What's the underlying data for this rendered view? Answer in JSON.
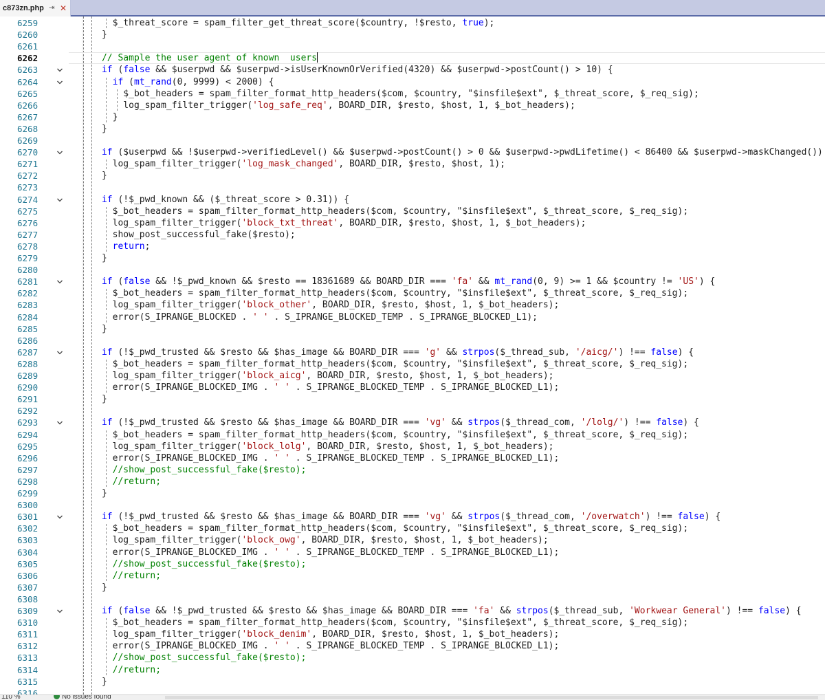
{
  "tab": {
    "title": "c873zn.php",
    "pin": "⇥",
    "close": "✕"
  },
  "status": {
    "zoom": "110 %",
    "issues": "No issues found"
  },
  "lines": [
    {
      "n": "6259",
      "code": "    $_threat_score = spam_filter_get_threat_score($country, !$resto, true);",
      "fold": false
    },
    {
      "n": "6260",
      "code": "  }",
      "fold": false
    },
    {
      "n": "6261",
      "code": "",
      "fold": false
    },
    {
      "n": "6262",
      "code": "  // Sample the user agent of known  users",
      "fold": false,
      "current": true
    },
    {
      "n": "6263",
      "code": "  if (false && $userpwd && $userpwd->isUserKnownOrVerified(4320) && $userpwd->postCount() > 10) {",
      "fold": true
    },
    {
      "n": "6264",
      "code": "    if (mt_rand(0, 9999) < 2000) {",
      "fold": true
    },
    {
      "n": "6265",
      "code": "      $_bot_headers = spam_filter_format_http_headers($com, $country, \"$insfile$ext\", $_threat_score, $_req_sig);",
      "fold": false
    },
    {
      "n": "6266",
      "code": "      log_spam_filter_trigger('log_safe_req', BOARD_DIR, $resto, $host, 1, $_bot_headers);",
      "fold": false
    },
    {
      "n": "6267",
      "code": "    }",
      "fold": false
    },
    {
      "n": "6268",
      "code": "  }",
      "fold": false
    },
    {
      "n": "6269",
      "code": "",
      "fold": false
    },
    {
      "n": "6270",
      "code": "  if ($userpwd && !$userpwd->verifiedLevel() && $userpwd->postCount() > 0 && $userpwd->pwdLifetime() < 86400 && $userpwd->maskChanged()) {",
      "fold": true
    },
    {
      "n": "6271",
      "code": "    log_spam_filter_trigger('log_mask_changed', BOARD_DIR, $resto, $host, 1);",
      "fold": false
    },
    {
      "n": "6272",
      "code": "  }",
      "fold": false
    },
    {
      "n": "6273",
      "code": "",
      "fold": false
    },
    {
      "n": "6274",
      "code": "  if (!$_pwd_known && ($_threat_score > 0.31)) {",
      "fold": true
    },
    {
      "n": "6275",
      "code": "    $_bot_headers = spam_filter_format_http_headers($com, $country, \"$insfile$ext\", $_threat_score, $_req_sig);",
      "fold": false
    },
    {
      "n": "6276",
      "code": "    log_spam_filter_trigger('block_txt_threat', BOARD_DIR, $resto, $host, 1, $_bot_headers);",
      "fold": false
    },
    {
      "n": "6277",
      "code": "    show_post_successful_fake($resto);",
      "fold": false
    },
    {
      "n": "6278",
      "code": "    return;",
      "fold": false
    },
    {
      "n": "6279",
      "code": "  }",
      "fold": false
    },
    {
      "n": "6280",
      "code": "",
      "fold": false
    },
    {
      "n": "6281",
      "code": "  if (false && !$_pwd_known && $resto == 18361689 && BOARD_DIR === 'fa' && mt_rand(0, 9) >= 1 && $country != 'US') {",
      "fold": true
    },
    {
      "n": "6282",
      "code": "    $_bot_headers = spam_filter_format_http_headers($com, $country, \"$insfile$ext\", $_threat_score, $_req_sig);",
      "fold": false
    },
    {
      "n": "6283",
      "code": "    log_spam_filter_trigger('block_other', BOARD_DIR, $resto, $host, 1, $_bot_headers);",
      "fold": false
    },
    {
      "n": "6284",
      "code": "    error(S_IPRANGE_BLOCKED . ' ' . S_IPRANGE_BLOCKED_TEMP . S_IPRANGE_BLOCKED_L1);",
      "fold": false
    },
    {
      "n": "6285",
      "code": "  }",
      "fold": false
    },
    {
      "n": "6286",
      "code": "",
      "fold": false
    },
    {
      "n": "6287",
      "code": "  if (!$_pwd_trusted && $resto && $has_image && BOARD_DIR === 'g' && strpos($_thread_sub, '/aicg/') !== false) {",
      "fold": true
    },
    {
      "n": "6288",
      "code": "    $_bot_headers = spam_filter_format_http_headers($com, $country, \"$insfile$ext\", $_threat_score, $_req_sig);",
      "fold": false
    },
    {
      "n": "6289",
      "code": "    log_spam_filter_trigger('block_aicg', BOARD_DIR, $resto, $host, 1, $_bot_headers);",
      "fold": false
    },
    {
      "n": "6290",
      "code": "    error(S_IPRANGE_BLOCKED_IMG . ' ' . S_IPRANGE_BLOCKED_TEMP . S_IPRANGE_BLOCKED_L1);",
      "fold": false
    },
    {
      "n": "6291",
      "code": "  }",
      "fold": false
    },
    {
      "n": "6292",
      "code": "",
      "fold": false
    },
    {
      "n": "6293",
      "code": "  if (!$_pwd_trusted && $resto && $has_image && BOARD_DIR === 'vg' && strpos($_thread_com, '/lolg/') !== false) {",
      "fold": true
    },
    {
      "n": "6294",
      "code": "    $_bot_headers = spam_filter_format_http_headers($com, $country, \"$insfile$ext\", $_threat_score, $_req_sig);",
      "fold": false
    },
    {
      "n": "6295",
      "code": "    log_spam_filter_trigger('block_lolg', BOARD_DIR, $resto, $host, 1, $_bot_headers);",
      "fold": false
    },
    {
      "n": "6296",
      "code": "    error(S_IPRANGE_BLOCKED_IMG . ' ' . S_IPRANGE_BLOCKED_TEMP . S_IPRANGE_BLOCKED_L1);",
      "fold": false
    },
    {
      "n": "6297",
      "code": "    //show_post_successful_fake($resto);",
      "fold": false
    },
    {
      "n": "6298",
      "code": "    //return;",
      "fold": false
    },
    {
      "n": "6299",
      "code": "  }",
      "fold": false
    },
    {
      "n": "6300",
      "code": "",
      "fold": false
    },
    {
      "n": "6301",
      "code": "  if (!$_pwd_trusted && $resto && $has_image && BOARD_DIR === 'vg' && strpos($_thread_com, '/overwatch') !== false) {",
      "fold": true
    },
    {
      "n": "6302",
      "code": "    $_bot_headers = spam_filter_format_http_headers($com, $country, \"$insfile$ext\", $_threat_score, $_req_sig);",
      "fold": false
    },
    {
      "n": "6303",
      "code": "    log_spam_filter_trigger('block_owg', BOARD_DIR, $resto, $host, 1, $_bot_headers);",
      "fold": false
    },
    {
      "n": "6304",
      "code": "    error(S_IPRANGE_BLOCKED_IMG . ' ' . S_IPRANGE_BLOCKED_TEMP . S_IPRANGE_BLOCKED_L1);",
      "fold": false
    },
    {
      "n": "6305",
      "code": "    //show_post_successful_fake($resto);",
      "fold": false
    },
    {
      "n": "6306",
      "code": "    //return;",
      "fold": false
    },
    {
      "n": "6307",
      "code": "  }",
      "fold": false
    },
    {
      "n": "6308",
      "code": "",
      "fold": false
    },
    {
      "n": "6309",
      "code": "  if (false && !$_pwd_trusted && $resto && $has_image && BOARD_DIR === 'fa' && strpos($_thread_sub, 'Workwear General') !== false) {",
      "fold": true
    },
    {
      "n": "6310",
      "code": "    $_bot_headers = spam_filter_format_http_headers($com, $country, \"$insfile$ext\", $_threat_score, $_req_sig);",
      "fold": false
    },
    {
      "n": "6311",
      "code": "    log_spam_filter_trigger('block_denim', BOARD_DIR, $resto, $host, 1, $_bot_headers);",
      "fold": false
    },
    {
      "n": "6312",
      "code": "    error(S_IPRANGE_BLOCKED_IMG . ' ' . S_IPRANGE_BLOCKED_TEMP . S_IPRANGE_BLOCKED_L1);",
      "fold": false
    },
    {
      "n": "6313",
      "code": "    //show_post_successful_fake($resto);",
      "fold": false
    },
    {
      "n": "6314",
      "code": "    //return;",
      "fold": false
    },
    {
      "n": "6315",
      "code": "  }",
      "fold": false
    },
    {
      "n": "6316",
      "code": "",
      "fold": false
    }
  ]
}
